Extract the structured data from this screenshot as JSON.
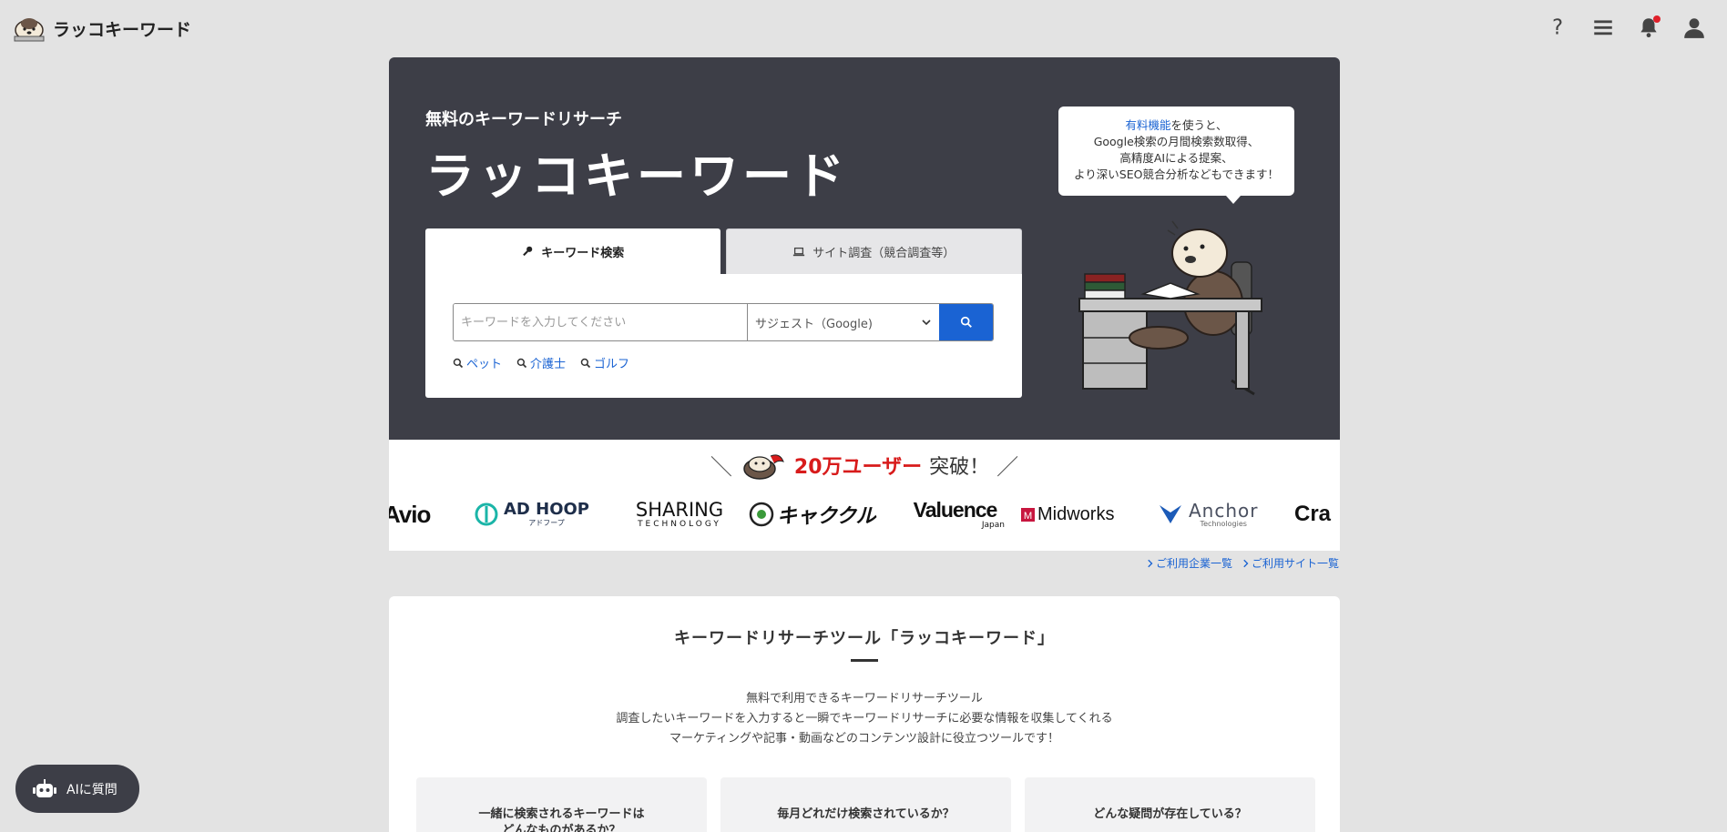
{
  "header": {
    "logo_text": "ラッコキーワード",
    "icons": [
      "question-icon",
      "menu-icon",
      "bell-icon",
      "user-icon"
    ]
  },
  "hero": {
    "subtitle": "無料のキーワードリサーチ",
    "title": "ラッコキーワード",
    "tabs": [
      {
        "label": "キーワード検索",
        "icon": "key-icon",
        "active": true
      },
      {
        "label": "サイト調査（競合調査等）",
        "icon": "laptop-icon",
        "active": false
      }
    ],
    "search": {
      "placeholder": "キーワードを入力してください",
      "select_value": "サジェスト（Google)"
    },
    "suggest_links": [
      "ペット",
      "介護士",
      "ゴルフ"
    ],
    "bubble": {
      "link": "有料機能",
      "line1_rest": "を使うと、",
      "line2": "Google検索の月間検索数取得、",
      "line3": "高精度AIによる提案、",
      "line4": "より深いSEO競合分析などもできます！"
    }
  },
  "users_banner": {
    "slash_left": "＼",
    "highlight": "20万ユーザー",
    "rest": "突破！",
    "slash_right": "／"
  },
  "company_logos": {
    "avio": "Avio",
    "adhoop": "AD HOOP",
    "adhoop_sub": "アドフープ",
    "sharing": "SHARING",
    "sharing_sub": "TECHNOLOGY",
    "kyakukuru": "キャククル",
    "valuence": "Valuence",
    "valuence_sub": "Japan",
    "midworks": "Midworks",
    "anchor": "Anchor",
    "anchor_sub": "Technologies",
    "cra": "Cra"
  },
  "under_links": [
    "ご利用企業一覧",
    "ご利用サイト一覧"
  ],
  "feature": {
    "title": "キーワードリサーチツール「ラッコキーワード」",
    "desc": [
      "無料で利用できるキーワードリサーチツール",
      "調査したいキーワードを入力すると一瞬でキーワードリサーチに必要な情報を収集してくれる",
      "マーケティングや記事・動画などのコンテンツ設計に役立つツールです！"
    ],
    "cards": [
      {
        "line1": "一緒に検索されるキーワードは",
        "line2": "どんなものがあるか？"
      },
      {
        "line1": "毎月どれだけ検索されているか？",
        "line2": ""
      },
      {
        "line1": "どんな疑問が存在している？",
        "line2": ""
      }
    ]
  },
  "ai_button": {
    "label": "AIに質問",
    "icon": "robot-icon"
  },
  "colors": {
    "accent": "#1a63d3",
    "hero_bg": "#3d3e47",
    "highlight_red": "#d81b1b",
    "page_bg": "#e3e3e3"
  }
}
